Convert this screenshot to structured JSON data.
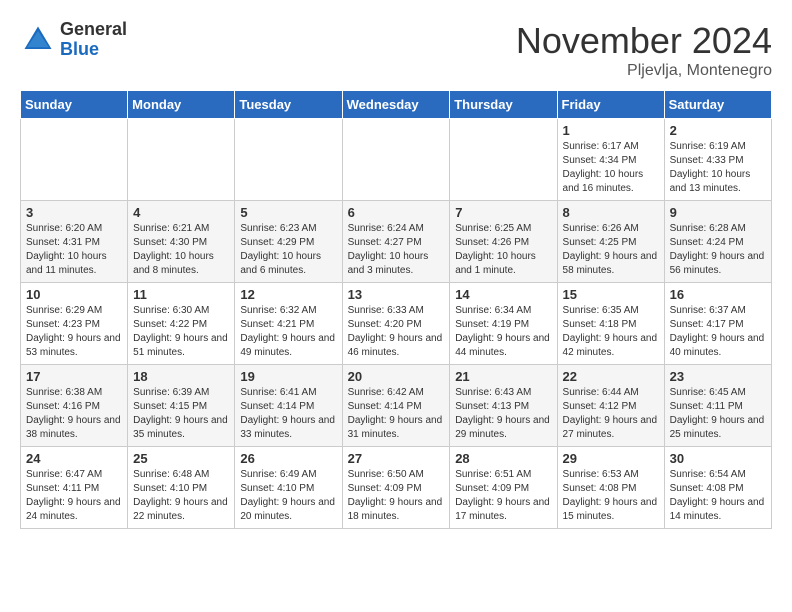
{
  "logo": {
    "general": "General",
    "blue": "Blue"
  },
  "title": "November 2024",
  "location": "Pljevlja, Montenegro",
  "days_of_week": [
    "Sunday",
    "Monday",
    "Tuesday",
    "Wednesday",
    "Thursday",
    "Friday",
    "Saturday"
  ],
  "weeks": [
    [
      {
        "day": "",
        "info": ""
      },
      {
        "day": "",
        "info": ""
      },
      {
        "day": "",
        "info": ""
      },
      {
        "day": "",
        "info": ""
      },
      {
        "day": "",
        "info": ""
      },
      {
        "day": "1",
        "info": "Sunrise: 6:17 AM\nSunset: 4:34 PM\nDaylight: 10 hours and 16 minutes."
      },
      {
        "day": "2",
        "info": "Sunrise: 6:19 AM\nSunset: 4:33 PM\nDaylight: 10 hours and 13 minutes."
      }
    ],
    [
      {
        "day": "3",
        "info": "Sunrise: 6:20 AM\nSunset: 4:31 PM\nDaylight: 10 hours and 11 minutes."
      },
      {
        "day": "4",
        "info": "Sunrise: 6:21 AM\nSunset: 4:30 PM\nDaylight: 10 hours and 8 minutes."
      },
      {
        "day": "5",
        "info": "Sunrise: 6:23 AM\nSunset: 4:29 PM\nDaylight: 10 hours and 6 minutes."
      },
      {
        "day": "6",
        "info": "Sunrise: 6:24 AM\nSunset: 4:27 PM\nDaylight: 10 hours and 3 minutes."
      },
      {
        "day": "7",
        "info": "Sunrise: 6:25 AM\nSunset: 4:26 PM\nDaylight: 10 hours and 1 minute."
      },
      {
        "day": "8",
        "info": "Sunrise: 6:26 AM\nSunset: 4:25 PM\nDaylight: 9 hours and 58 minutes."
      },
      {
        "day": "9",
        "info": "Sunrise: 6:28 AM\nSunset: 4:24 PM\nDaylight: 9 hours and 56 minutes."
      }
    ],
    [
      {
        "day": "10",
        "info": "Sunrise: 6:29 AM\nSunset: 4:23 PM\nDaylight: 9 hours and 53 minutes."
      },
      {
        "day": "11",
        "info": "Sunrise: 6:30 AM\nSunset: 4:22 PM\nDaylight: 9 hours and 51 minutes."
      },
      {
        "day": "12",
        "info": "Sunrise: 6:32 AM\nSunset: 4:21 PM\nDaylight: 9 hours and 49 minutes."
      },
      {
        "day": "13",
        "info": "Sunrise: 6:33 AM\nSunset: 4:20 PM\nDaylight: 9 hours and 46 minutes."
      },
      {
        "day": "14",
        "info": "Sunrise: 6:34 AM\nSunset: 4:19 PM\nDaylight: 9 hours and 44 minutes."
      },
      {
        "day": "15",
        "info": "Sunrise: 6:35 AM\nSunset: 4:18 PM\nDaylight: 9 hours and 42 minutes."
      },
      {
        "day": "16",
        "info": "Sunrise: 6:37 AM\nSunset: 4:17 PM\nDaylight: 9 hours and 40 minutes."
      }
    ],
    [
      {
        "day": "17",
        "info": "Sunrise: 6:38 AM\nSunset: 4:16 PM\nDaylight: 9 hours and 38 minutes."
      },
      {
        "day": "18",
        "info": "Sunrise: 6:39 AM\nSunset: 4:15 PM\nDaylight: 9 hours and 35 minutes."
      },
      {
        "day": "19",
        "info": "Sunrise: 6:41 AM\nSunset: 4:14 PM\nDaylight: 9 hours and 33 minutes."
      },
      {
        "day": "20",
        "info": "Sunrise: 6:42 AM\nSunset: 4:14 PM\nDaylight: 9 hours and 31 minutes."
      },
      {
        "day": "21",
        "info": "Sunrise: 6:43 AM\nSunset: 4:13 PM\nDaylight: 9 hours and 29 minutes."
      },
      {
        "day": "22",
        "info": "Sunrise: 6:44 AM\nSunset: 4:12 PM\nDaylight: 9 hours and 27 minutes."
      },
      {
        "day": "23",
        "info": "Sunrise: 6:45 AM\nSunset: 4:11 PM\nDaylight: 9 hours and 25 minutes."
      }
    ],
    [
      {
        "day": "24",
        "info": "Sunrise: 6:47 AM\nSunset: 4:11 PM\nDaylight: 9 hours and 24 minutes."
      },
      {
        "day": "25",
        "info": "Sunrise: 6:48 AM\nSunset: 4:10 PM\nDaylight: 9 hours and 22 minutes."
      },
      {
        "day": "26",
        "info": "Sunrise: 6:49 AM\nSunset: 4:10 PM\nDaylight: 9 hours and 20 minutes."
      },
      {
        "day": "27",
        "info": "Sunrise: 6:50 AM\nSunset: 4:09 PM\nDaylight: 9 hours and 18 minutes."
      },
      {
        "day": "28",
        "info": "Sunrise: 6:51 AM\nSunset: 4:09 PM\nDaylight: 9 hours and 17 minutes."
      },
      {
        "day": "29",
        "info": "Sunrise: 6:53 AM\nSunset: 4:08 PM\nDaylight: 9 hours and 15 minutes."
      },
      {
        "day": "30",
        "info": "Sunrise: 6:54 AM\nSunset: 4:08 PM\nDaylight: 9 hours and 14 minutes."
      }
    ]
  ]
}
